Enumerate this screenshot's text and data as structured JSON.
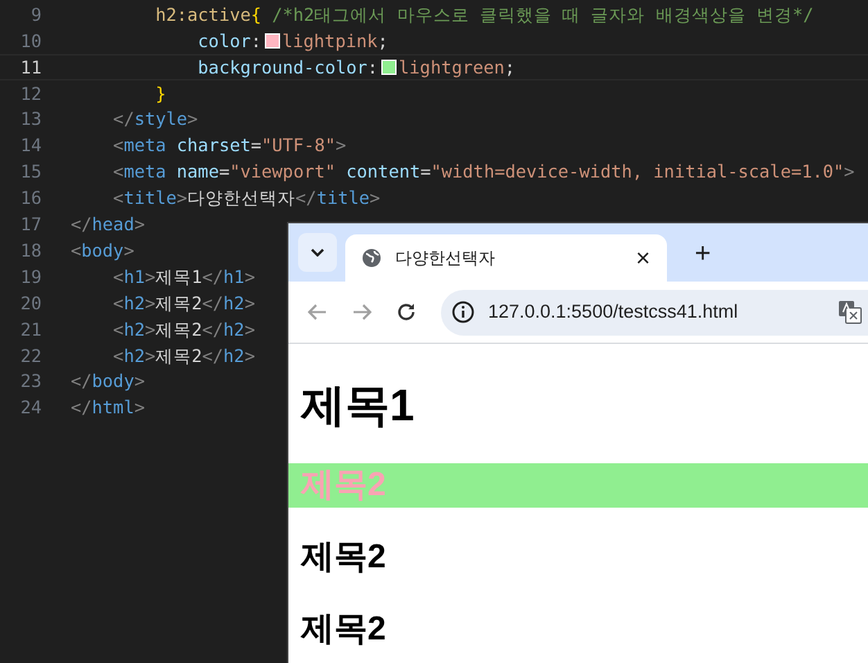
{
  "editor": {
    "lines": [
      {
        "number": "9",
        "current": false,
        "tokens": [
          {
            "kind": "selector",
            "text": "        h2:active"
          },
          {
            "kind": "brace",
            "text": "{"
          },
          {
            "kind": "comment",
            "text": " /*h2태그에서 마우스로 클릭했을 때 글자와 배경색상을 변경*/"
          }
        ]
      },
      {
        "number": "10",
        "current": false,
        "tokens": [
          {
            "kind": "property",
            "text": "            color"
          },
          {
            "kind": "text",
            "text": ":"
          },
          {
            "kind": "swatch",
            "color": "#ffb6c1"
          },
          {
            "kind": "value",
            "text": "lightpink"
          },
          {
            "kind": "text",
            "text": ";"
          }
        ]
      },
      {
        "number": "11",
        "current": true,
        "tokens": [
          {
            "kind": "property",
            "text": "            background-color"
          },
          {
            "kind": "text",
            "text": ":"
          },
          {
            "kind": "swatch",
            "color": "#90ee90"
          },
          {
            "kind": "value",
            "text": "lightgreen"
          },
          {
            "kind": "text",
            "text": ";"
          }
        ]
      },
      {
        "number": "12",
        "current": false,
        "tokens": [
          {
            "kind": "brace",
            "text": "        }"
          }
        ]
      },
      {
        "number": "13",
        "current": false,
        "tokens": [
          {
            "kind": "bracket",
            "text": "    </"
          },
          {
            "kind": "tag",
            "text": "style"
          },
          {
            "kind": "bracket",
            "text": ">"
          }
        ]
      },
      {
        "number": "14",
        "current": false,
        "tokens": [
          {
            "kind": "bracket",
            "text": "    <"
          },
          {
            "kind": "tag",
            "text": "meta"
          },
          {
            "kind": "attr",
            "text": " charset"
          },
          {
            "kind": "text",
            "text": "="
          },
          {
            "kind": "value",
            "text": "\"UTF-8\""
          },
          {
            "kind": "bracket",
            "text": ">"
          }
        ]
      },
      {
        "number": "15",
        "current": false,
        "tokens": [
          {
            "kind": "bracket",
            "text": "    <"
          },
          {
            "kind": "tag",
            "text": "meta"
          },
          {
            "kind": "attr",
            "text": " name"
          },
          {
            "kind": "text",
            "text": "="
          },
          {
            "kind": "value",
            "text": "\"viewport\""
          },
          {
            "kind": "attr",
            "text": " content"
          },
          {
            "kind": "text",
            "text": "="
          },
          {
            "kind": "value",
            "text": "\"width=device-width, initial-scale=1.0\""
          },
          {
            "kind": "bracket",
            "text": ">"
          }
        ]
      },
      {
        "number": "16",
        "current": false,
        "tokens": [
          {
            "kind": "bracket",
            "text": "    <"
          },
          {
            "kind": "tag",
            "text": "title"
          },
          {
            "kind": "bracket",
            "text": ">"
          },
          {
            "kind": "text",
            "text": "다양한선택자"
          },
          {
            "kind": "bracket",
            "text": "</"
          },
          {
            "kind": "tag",
            "text": "title"
          },
          {
            "kind": "bracket",
            "text": ">"
          }
        ]
      },
      {
        "number": "17",
        "current": false,
        "tokens": [
          {
            "kind": "bracket",
            "text": "</"
          },
          {
            "kind": "tag",
            "text": "head"
          },
          {
            "kind": "bracket",
            "text": ">"
          }
        ]
      },
      {
        "number": "18",
        "current": false,
        "tokens": [
          {
            "kind": "bracket",
            "text": "<"
          },
          {
            "kind": "tag",
            "text": "body"
          },
          {
            "kind": "bracket",
            "text": ">"
          }
        ]
      },
      {
        "number": "19",
        "current": false,
        "tokens": [
          {
            "kind": "bracket",
            "text": "    <"
          },
          {
            "kind": "tag",
            "text": "h1"
          },
          {
            "kind": "bracket",
            "text": ">"
          },
          {
            "kind": "text",
            "text": "제목1"
          },
          {
            "kind": "bracket",
            "text": "</"
          },
          {
            "kind": "tag",
            "text": "h1"
          },
          {
            "kind": "bracket",
            "text": ">"
          }
        ]
      },
      {
        "number": "20",
        "current": false,
        "tokens": [
          {
            "kind": "bracket",
            "text": "    <"
          },
          {
            "kind": "tag",
            "text": "h2"
          },
          {
            "kind": "bracket",
            "text": ">"
          },
          {
            "kind": "text",
            "text": "제목2"
          },
          {
            "kind": "bracket",
            "text": "</"
          },
          {
            "kind": "tag",
            "text": "h2"
          },
          {
            "kind": "bracket",
            "text": ">"
          }
        ]
      },
      {
        "number": "21",
        "current": false,
        "tokens": [
          {
            "kind": "bracket",
            "text": "    <"
          },
          {
            "kind": "tag",
            "text": "h2"
          },
          {
            "kind": "bracket",
            "text": ">"
          },
          {
            "kind": "text",
            "text": "제목2"
          },
          {
            "kind": "bracket",
            "text": "</"
          },
          {
            "kind": "tag",
            "text": "h2"
          },
          {
            "kind": "bracket",
            "text": ">"
          }
        ]
      },
      {
        "number": "22",
        "current": false,
        "tokens": [
          {
            "kind": "bracket",
            "text": "    <"
          },
          {
            "kind": "tag",
            "text": "h2"
          },
          {
            "kind": "bracket",
            "text": ">"
          },
          {
            "kind": "text",
            "text": "제목2"
          },
          {
            "kind": "bracket",
            "text": "</"
          },
          {
            "kind": "tag",
            "text": "h2"
          },
          {
            "kind": "bracket",
            "text": ">"
          }
        ]
      },
      {
        "number": "23",
        "current": false,
        "tokens": [
          {
            "kind": "bracket",
            "text": "</"
          },
          {
            "kind": "tag",
            "text": "body"
          },
          {
            "kind": "bracket",
            "text": ">"
          }
        ]
      },
      {
        "number": "24",
        "current": false,
        "tokens": [
          {
            "kind": "bracket",
            "text": "</"
          },
          {
            "kind": "tag",
            "text": "html"
          },
          {
            "kind": "bracket",
            "text": ">"
          }
        ]
      }
    ]
  },
  "browser": {
    "tab": {
      "title": "다양한선택자",
      "close": "×",
      "selected": true
    },
    "new_tab": "+",
    "address": "127.0.0.1:5500/testcss41.html",
    "page": {
      "headings": [
        {
          "kind": "h1",
          "text": "제목1",
          "active": false
        },
        {
          "kind": "h2",
          "text": "제목2",
          "active": true
        },
        {
          "kind": "h2",
          "text": "제목2",
          "active": false
        },
        {
          "kind": "h2",
          "text": "제목2",
          "active": false
        }
      ]
    }
  }
}
